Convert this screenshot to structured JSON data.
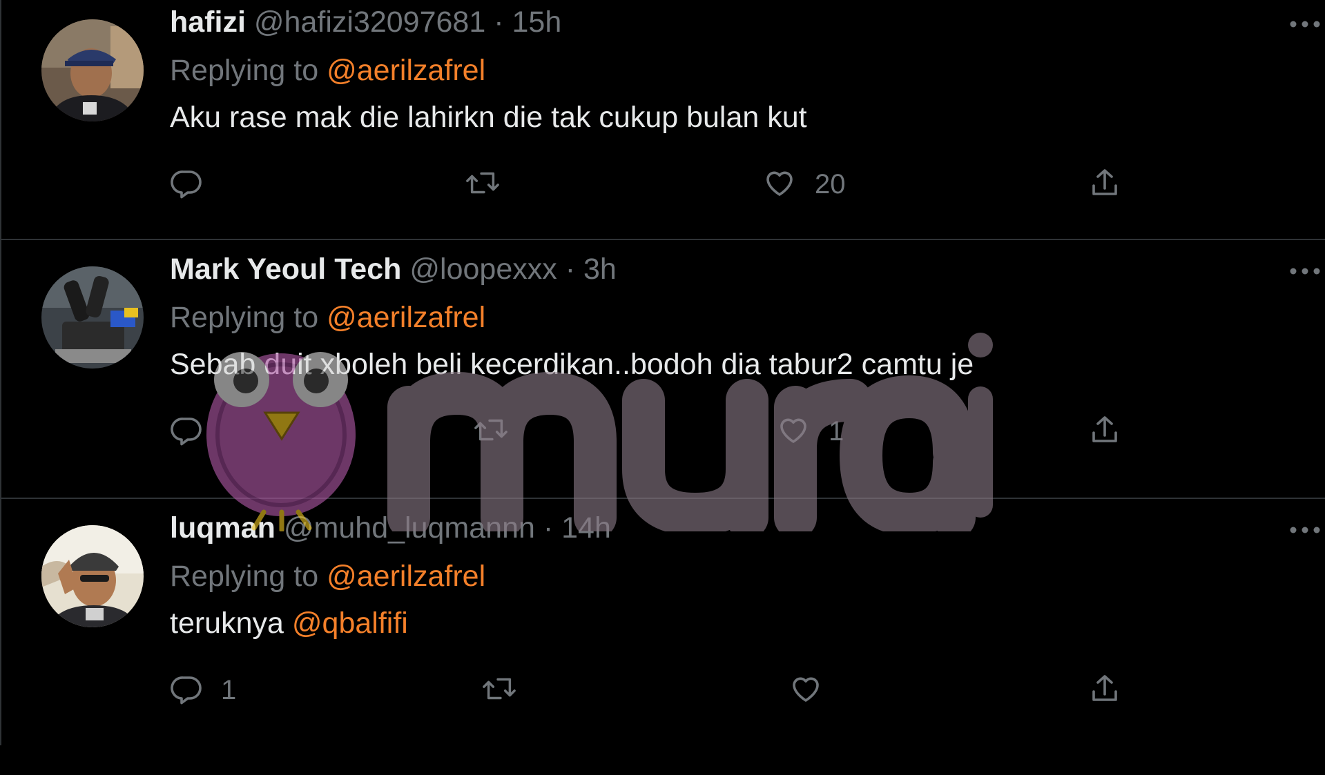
{
  "colors": {
    "background": "#000000",
    "text": "#e7e9ea",
    "muted": "#71767b",
    "mention": "#f4802a",
    "divider": "#2f3336",
    "watermark": "#b05aa6"
  },
  "watermark": {
    "text": "murai"
  },
  "tweets": [
    {
      "name": "hafizi",
      "handle": "@hafizi32097681",
      "separator": "·",
      "time": "15h",
      "replying_prefix": "Replying to",
      "replying_to": "@aerilzafrel",
      "text": "Aku rase mak die lahirkn die tak cukup bulan kut",
      "text_mention": "",
      "reply_count": "",
      "retweet_count": "",
      "like_count": "20",
      "icons": [
        "reply-icon",
        "retweet-icon",
        "like-icon",
        "share-icon",
        "more-icon"
      ]
    },
    {
      "name": "Mark Yeoul Tech",
      "handle": "@loopexxx",
      "separator": "·",
      "time": "3h",
      "replying_prefix": "Replying to",
      "replying_to": "@aerilzafrel",
      "text": "Sebab duit xboleh beli kecerdikan..bodoh dia tabur2 camtu je",
      "text_mention": "",
      "reply_count": "",
      "retweet_count": "",
      "like_count": "1",
      "icons": [
        "reply-icon",
        "retweet-icon",
        "like-icon",
        "share-icon",
        "more-icon"
      ]
    },
    {
      "name": "luqman",
      "handle": "@muhd_luqmannn",
      "separator": "·",
      "time": "14h",
      "replying_prefix": "Replying to",
      "replying_to": "@aerilzafrel",
      "text": "teruknya ",
      "text_mention": "@qbalfifi",
      "reply_count": "1",
      "retweet_count": "",
      "like_count": "",
      "icons": [
        "reply-icon",
        "retweet-icon",
        "like-icon",
        "share-icon",
        "more-icon"
      ]
    }
  ]
}
